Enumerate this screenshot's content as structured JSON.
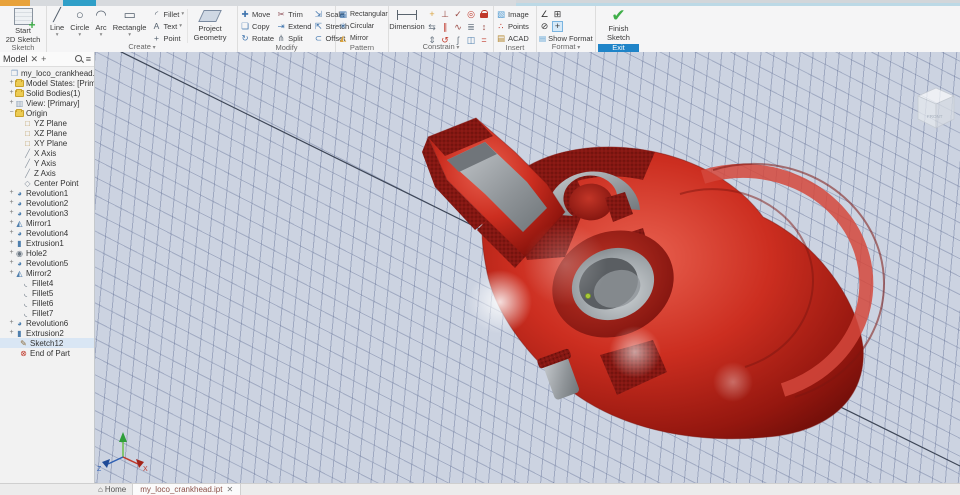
{
  "colors": {
    "grid_bg": "#ccd3e1",
    "file_tab": "#e8a23b",
    "active_tab": "#2f9fc8",
    "accent_blue": "#1f84c8",
    "model_red": "#cc2e20",
    "model_red_dark": "#7e1510",
    "cut_hatch": "#841712",
    "steel_gray": "#9aa0a4",
    "finish_green": "#3fae49",
    "center_dot_green": "#a8c838"
  },
  "ribbon": {
    "sketch_group": {
      "label": "Sketch",
      "start_line1": "Start",
      "start_line2": "2D Sketch"
    },
    "create_group": {
      "label": "Create",
      "tools": [
        {
          "name": "line-tool",
          "label": "Line",
          "glyph": "╱",
          "color": "#55616e"
        },
        {
          "name": "circle-tool",
          "label": "Circle",
          "glyph": "○",
          "color": "#55616e"
        },
        {
          "name": "arc-tool",
          "label": "Arc",
          "glyph": "◠",
          "color": "#55616e"
        },
        {
          "name": "rectangle-tool",
          "label": "Rectangle",
          "glyph": "▭",
          "color": "#55616e"
        }
      ],
      "small_tools": [
        {
          "name": "fillet-tool",
          "label": "Fillet",
          "glyph": "◜",
          "color": "#55616e",
          "dd": "▾"
        },
        {
          "name": "text-tool",
          "label": "Text",
          "glyph": "A",
          "color": "#55616e",
          "dd": "▾"
        },
        {
          "name": "point-tool",
          "label": "Point",
          "glyph": "+",
          "color": "#55616e",
          "dd": ""
        }
      ],
      "pg_line1": "Project",
      "pg_line2": "Geometry"
    },
    "modify_group": {
      "label": "Modify",
      "items": [
        {
          "name": "move-tool",
          "label": "Move",
          "glyph": "✚",
          "color": "#3f74ad"
        },
        {
          "name": "copy-tool",
          "label": "Copy",
          "glyph": "❏",
          "color": "#3f74ad"
        },
        {
          "name": "rotate-tool",
          "label": "Rotate",
          "glyph": "↻",
          "color": "#3f74ad"
        },
        {
          "name": "trim-tool",
          "label": "Trim",
          "glyph": "✂",
          "color": "#8a4a52"
        },
        {
          "name": "extend-tool",
          "label": "Extend",
          "glyph": "⇥",
          "color": "#3f74ad"
        },
        {
          "name": "split-tool",
          "label": "Split",
          "glyph": "⋔",
          "color": "#6a7682"
        },
        {
          "name": "scale-tool",
          "label": "Scale",
          "glyph": "⇲",
          "color": "#3f74ad"
        },
        {
          "name": "stretch-tool",
          "label": "Stretch",
          "glyph": "⇱",
          "color": "#3f74ad"
        },
        {
          "name": "offset-tool",
          "label": "Offset",
          "glyph": "⊂",
          "color": "#3f74ad"
        }
      ]
    },
    "pattern_group": {
      "label": "Pattern",
      "items": [
        {
          "name": "rectangular-pattern-tool",
          "label": "Rectangular",
          "glyph": "▦",
          "color": "#3f74ad"
        },
        {
          "name": "circular-pattern-tool",
          "label": "Circular",
          "glyph": "✳",
          "color": "#3f74ad"
        },
        {
          "name": "mirror-pattern-tool",
          "label": "Mirror",
          "glyph": "◭",
          "color": "#d9a23c"
        }
      ]
    },
    "constrain_group": {
      "label": "Constrain",
      "dimension_label": "Dimension",
      "icons": [
        {
          "name": "constraint-coincident-icon",
          "glyph": "+",
          "color": "#d9a23c"
        },
        {
          "name": "constraint-perpendicular-icon",
          "glyph": "⊥",
          "color": "#9a4a44"
        },
        {
          "name": "constraint-tangent-icon",
          "glyph": "✓",
          "color": "#9a4a44"
        },
        {
          "name": "constraint-concentric-icon",
          "glyph": "◎",
          "color": "#c0392b"
        },
        {
          "name": "constraint-fix-icon",
          "glyph": "",
          "color": "#c0392b",
          "lock": true
        },
        {
          "name": "constraint-symmetric-icon",
          "glyph": "⇆",
          "color": "#6a7682"
        },
        {
          "name": "constraint-parallel-icon",
          "glyph": "∥",
          "color": "#c0392b"
        },
        {
          "name": "constraint-smooth-icon",
          "glyph": "∿",
          "color": "#9a4a44"
        },
        {
          "name": "constraint-collinear-icon",
          "glyph": "≣",
          "color": "#6a7682"
        },
        {
          "name": "constraint-vertical-icon",
          "glyph": "↕",
          "color": "#9a4a44"
        },
        {
          "name": "constraint-settings-icon",
          "glyph": "⇕",
          "color": "#6a7682"
        },
        {
          "name": "constraint-horizontal-icon",
          "glyph": "↺",
          "color": "#c0392b"
        },
        {
          "name": "constraint-smooth-g2-icon",
          "glyph": "ʃ",
          "color": "#6a7682"
        },
        {
          "name": "constraint-colinear-icon",
          "glyph": "◫",
          "color": "#4f7fae"
        },
        {
          "name": "constraint-equal-icon",
          "glyph": "=",
          "color": "#c0392b"
        }
      ]
    },
    "insert_group": {
      "label": "Insert",
      "items": [
        {
          "name": "insert-image-tool",
          "label": "Image",
          "glyph": "▧",
          "color": "#4f9ad1"
        },
        {
          "name": "insert-points-tool",
          "label": "Points",
          "glyph": "∴",
          "color": "#c0392b"
        },
        {
          "name": "insert-acad-tool",
          "label": "ACAD",
          "glyph": "▤",
          "color": "#b3862f"
        }
      ]
    },
    "format_group": {
      "label": "Format",
      "show_format_label": "Show Format",
      "icons": [
        {
          "name": "degrees-format-icon",
          "glyph": "∠",
          "color": "#c0392b",
          "active": false
        },
        {
          "name": "snap-grid-icon",
          "glyph": "⊞",
          "color": "#6a7682",
          "active": false
        },
        {
          "name": "slice-graphics-icon",
          "glyph": "⊘",
          "color": "#6a7682",
          "active": false
        },
        {
          "name": "center-snap-icon",
          "glyph": "+",
          "color": "#4f7fae",
          "active": true
        }
      ],
      "show_format_glyph": "▤"
    },
    "exit_group": {
      "label": "Exit",
      "check": "✔",
      "finish_line1": "Finish",
      "finish_line2": "Sketch"
    }
  },
  "browser": {
    "tab_label": "Model",
    "close_glyph": "✕",
    "add_glyph": "+",
    "menu_glyph": "≡",
    "tree": [
      {
        "name": "part-root",
        "label": "my_loco_crankhead.ipt",
        "glyph": "❒",
        "color": "#7a9ac0",
        "expander": "",
        "pad": "3px"
      },
      {
        "label": "Model States: [Primary]",
        "folder": true,
        "glyph": "",
        "expander": "+",
        "pad": "8px"
      },
      {
        "label": "Solid Bodies(1)",
        "folder": true,
        "glyph": "",
        "expander": "+",
        "pad": "8px"
      },
      {
        "label": "View: [Primary]",
        "glyph": "▥",
        "color": "#8fa3b8",
        "expander": "+",
        "pad": "8px"
      },
      {
        "label": "Origin",
        "folder": true,
        "glyph": "",
        "expander": "−",
        "pad": "8px"
      },
      {
        "label": "YZ Plane",
        "glyph": "□",
        "color": "#b9995a",
        "expander": "",
        "pad": "16px"
      },
      {
        "label": "XZ Plane",
        "glyph": "□",
        "color": "#b9995a",
        "expander": "",
        "pad": "16px"
      },
      {
        "label": "XY Plane",
        "glyph": "□",
        "color": "#b9995a",
        "expander": "",
        "pad": "16px"
      },
      {
        "label": "X Axis",
        "glyph": "╱",
        "color": "#8a94a0",
        "expander": "",
        "pad": "16px"
      },
      {
        "label": "Y Axis",
        "glyph": "╱",
        "color": "#8a94a0",
        "expander": "",
        "pad": "16px"
      },
      {
        "label": "Z Axis",
        "glyph": "╱",
        "color": "#8a94a0",
        "expander": "",
        "pad": "16px"
      },
      {
        "label": "Center Point",
        "glyph": "◇",
        "color": "#8a94a0",
        "expander": "",
        "pad": "16px"
      },
      {
        "label": "Revolution1",
        "glyph": "◕",
        "color": "#4f7fae",
        "expander": "+",
        "pad": "8px"
      },
      {
        "label": "Revolution2",
        "glyph": "◕",
        "color": "#4f7fae",
        "expander": "+",
        "pad": "8px"
      },
      {
        "label": "Revolution3",
        "glyph": "◕",
        "color": "#4f7fae",
        "expander": "+",
        "pad": "8px"
      },
      {
        "label": "Mirror1",
        "glyph": "◭",
        "color": "#4f7fae",
        "expander": "+",
        "pad": "8px"
      },
      {
        "label": "Revolution4",
        "glyph": "◕",
        "color": "#4f7fae",
        "expander": "+",
        "pad": "8px"
      },
      {
        "label": "Extrusion1",
        "glyph": "▮",
        "color": "#4f7fae",
        "expander": "+",
        "pad": "8px"
      },
      {
        "label": "Hole2",
        "glyph": "◉",
        "color": "#6a7682",
        "expander": "+",
        "pad": "8px"
      },
      {
        "label": "Revolution5",
        "glyph": "◕",
        "color": "#4f7fae",
        "expander": "+",
        "pad": "8px"
      },
      {
        "label": "Mirror2",
        "glyph": "◭",
        "color": "#4f7fae",
        "expander": "+",
        "pad": "8px"
      },
      {
        "label": "Fillet4",
        "glyph": "◟",
        "color": "#6a7682",
        "expander": "",
        "pad": "14px"
      },
      {
        "label": "Fillet5",
        "glyph": "◟",
        "color": "#6a7682",
        "expander": "",
        "pad": "14px"
      },
      {
        "label": "Fillet6",
        "glyph": "◟",
        "color": "#6a7682",
        "expander": "",
        "pad": "14px"
      },
      {
        "label": "Fillet7",
        "glyph": "◟",
        "color": "#6a7682",
        "expander": "",
        "pad": "14px"
      },
      {
        "label": "Revolution6",
        "glyph": "◕",
        "color": "#4f7fae",
        "expander": "+",
        "pad": "8px"
      },
      {
        "label": "Extrusion2",
        "glyph": "▮",
        "color": "#4f7fae",
        "expander": "+",
        "pad": "8px"
      },
      {
        "label": "Sketch12",
        "glyph": "✎",
        "color": "#8a6a3a",
        "expander": "",
        "pad": "12px",
        "selected": true
      },
      {
        "label": "End of Part",
        "glyph": "⊗",
        "color": "#c0392b",
        "expander": "",
        "pad": "12px"
      }
    ]
  },
  "viewport": {
    "viewcube_label": "FRONT",
    "triad_x_label": "X",
    "triad_z_label": "Z"
  },
  "bottom_bar": {
    "home_glyph": "⌂",
    "home_label": "Home",
    "doc_tab_label": "my_loco_crankhead.ipt",
    "doc_tab_close": "✕"
  }
}
